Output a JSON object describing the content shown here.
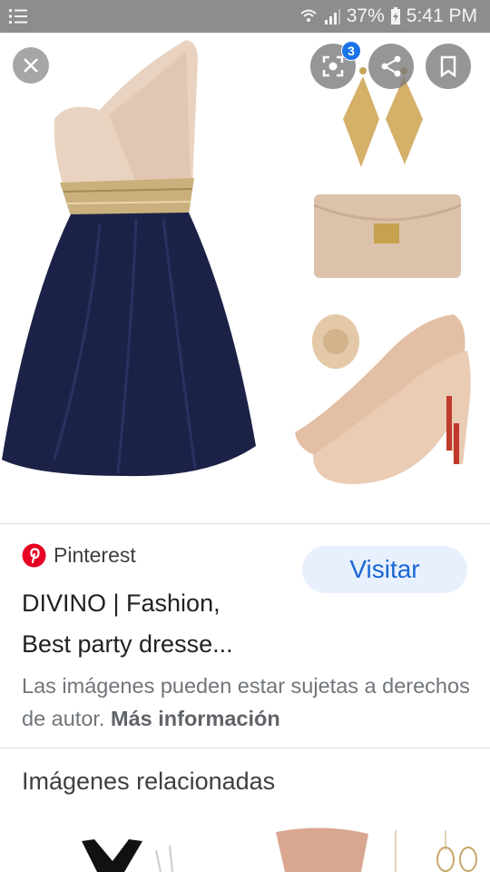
{
  "status_bar": {
    "battery": "37%",
    "time": "5:41 PM"
  },
  "viewer": {
    "lens_badge_count": "3"
  },
  "info": {
    "source": "Pinterest",
    "visit_button": "Visitar",
    "title_line1": "DIVINO | Fashion,",
    "title_line2": "Best party dresse...",
    "notice_text": "Las imágenes pueden estar sujetas a derechos de autor. ",
    "notice_link": "Más información"
  },
  "related": {
    "heading": "Imágenes relacionadas"
  },
  "colors": {
    "accent": "#1967d2",
    "pinterest": "#e60023",
    "status_bar": "#8d8d8d"
  }
}
